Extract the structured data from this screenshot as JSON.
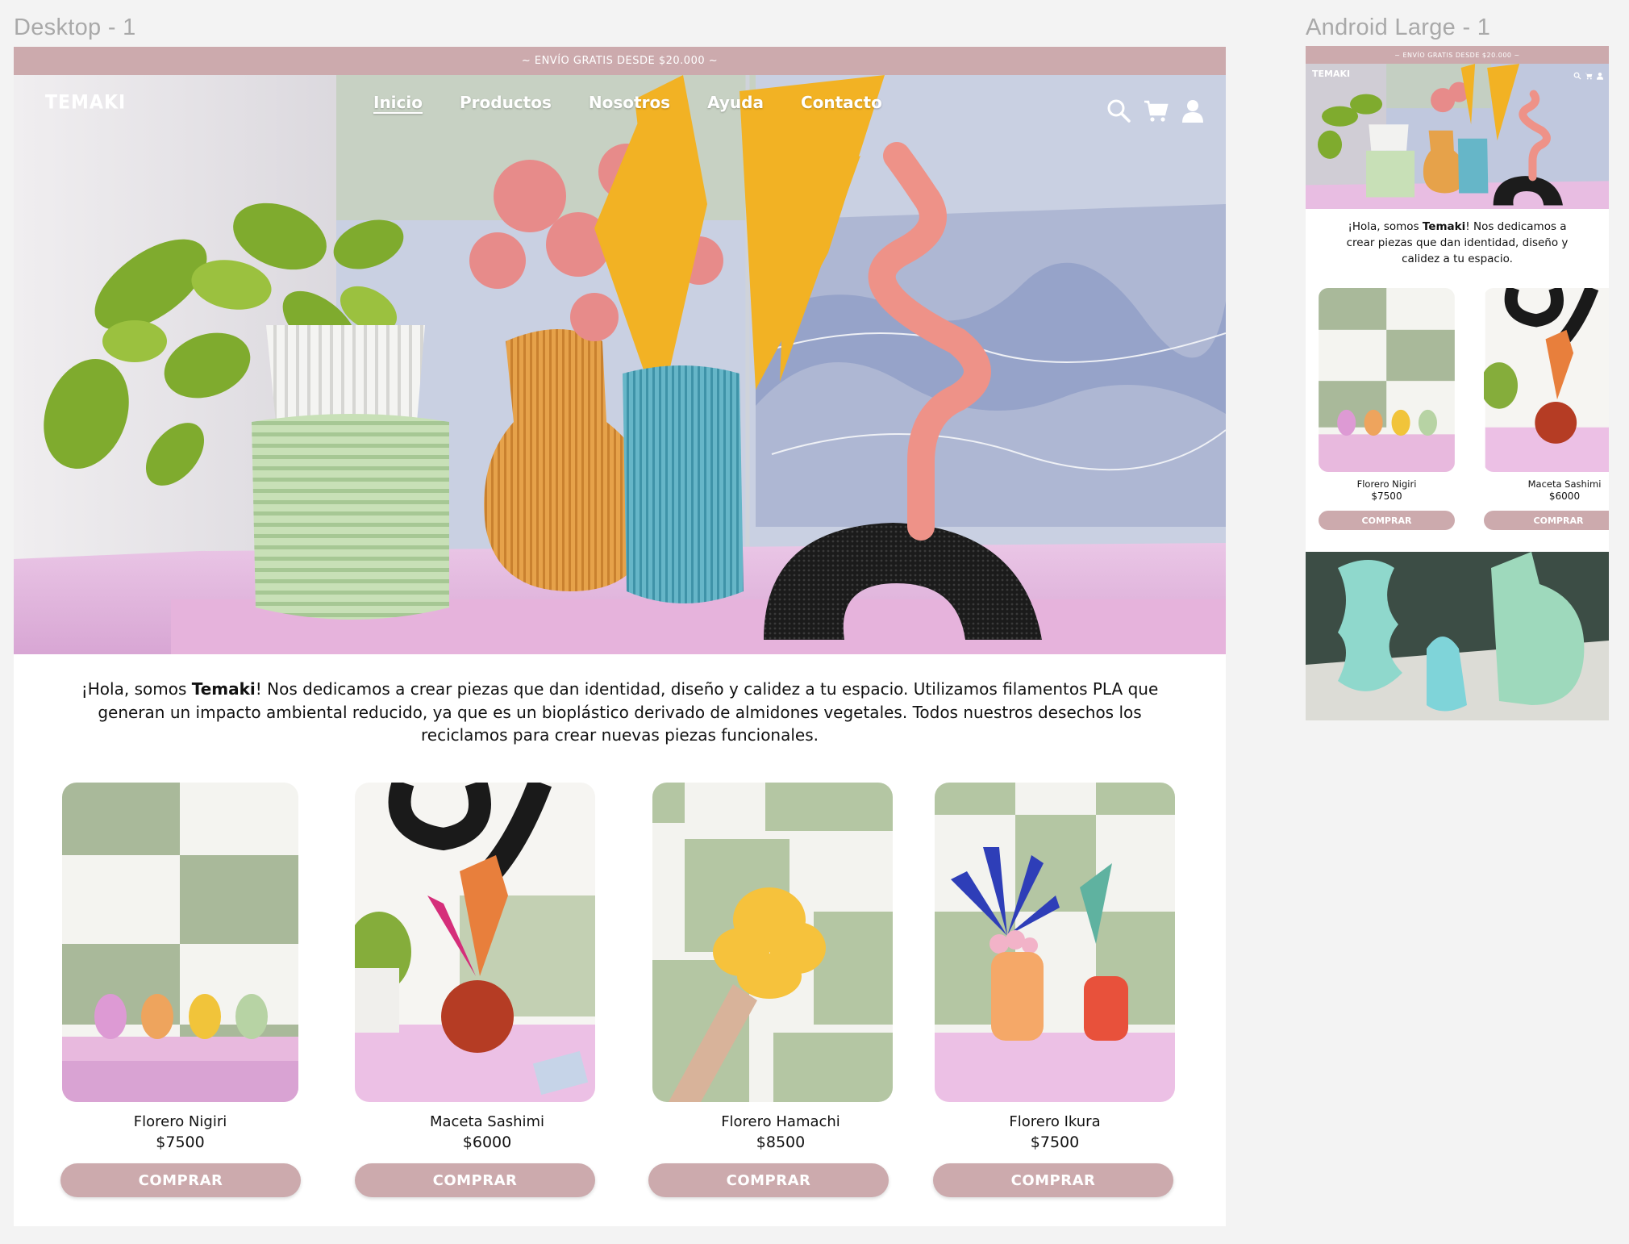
{
  "frames": {
    "desktop_title": "Desktop - 1",
    "mobile_title": "Android Large - 1"
  },
  "promo": "~ ENVÍO GRATIS DESDE $20.000 ~",
  "brand": "TEMAKI",
  "nav": {
    "items": [
      {
        "label": "Inicio",
        "active": true
      },
      {
        "label": "Productos"
      },
      {
        "label": "Nosotros"
      },
      {
        "label": "Ayuda"
      },
      {
        "label": "Contacto"
      }
    ],
    "icons": [
      "search-icon",
      "cart-icon",
      "user-icon"
    ]
  },
  "intro": {
    "prefix": "¡Hola, somos ",
    "brand": "Temaki",
    "desktop_rest": "! Nos dedicamos a crear piezas que dan identidad, diseño y calidez a tu espacio. Utilizamos filamentos PLA que generan un impacto ambiental reducido, ya que es un bioplástico derivado de almidones vegetales. Todos nuestros desechos los reciclamos para crear nuevas piezas funcionales.",
    "mobile_rest": "! Nos dedicamos a crear piezas que dan identidad, diseño y calidez a tu espacio."
  },
  "products": [
    {
      "name": "Florero Nigiri",
      "price": "$7500",
      "cta": "COMPRAR"
    },
    {
      "name": "Maceta Sashimi",
      "price": "$6000",
      "cta": "COMPRAR"
    },
    {
      "name": "Florero Hamachi",
      "price": "$8500",
      "cta": "COMPRAR"
    },
    {
      "name": "Florero Ikura",
      "price": "$7500",
      "cta": "COMPRAR"
    }
  ],
  "colors": {
    "accent": "#ccaaad",
    "sage": "#a9b99a",
    "pink_shelf": "#e8b9de"
  }
}
